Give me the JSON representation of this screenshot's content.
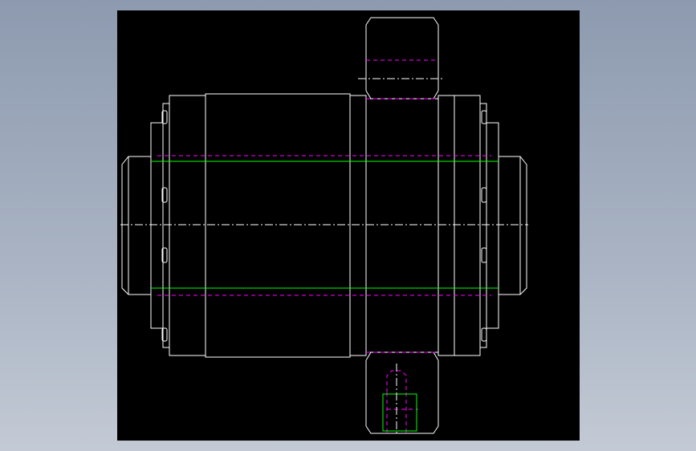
{
  "drawing": {
    "background_color": "#000000",
    "outline_color": "#ffffff",
    "hidden_line_color": "#ff00ff",
    "thread_line_color": "#00ff00",
    "center_line_color": "#ffffff",
    "layers": [
      "outline",
      "hidden-lines",
      "thread-lines",
      "center-lines"
    ]
  }
}
